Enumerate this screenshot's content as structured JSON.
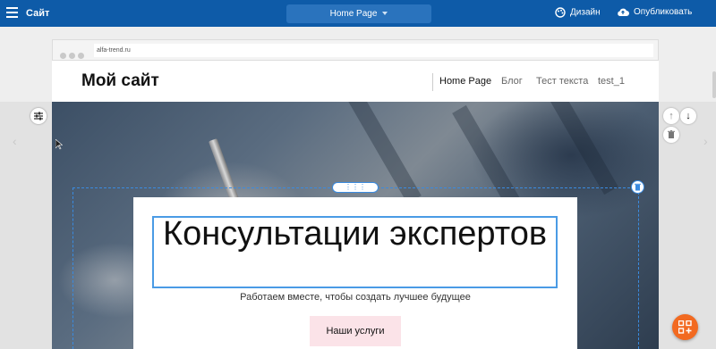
{
  "topbar": {
    "site_label": "Сайт",
    "page_select": "Home Page",
    "design_label": "Дизайн",
    "publish_label": "Опубликовать"
  },
  "browser": {
    "url": "alfa-trend.ru"
  },
  "site": {
    "logo": "Мой сайт",
    "nav": [
      "Home Page",
      "Блог",
      "Тест текста",
      "test_1"
    ]
  },
  "hero": {
    "title": "Консультации экспертов",
    "subtitle": "Работаем вместе, чтобы создать лучшее будущее",
    "cta": "Наши услуги"
  },
  "colors": {
    "toolbar": "#0e5ba8",
    "selection": "#3a8be0",
    "cta_bg": "#fbe3e8",
    "fab": "#f26a21"
  }
}
